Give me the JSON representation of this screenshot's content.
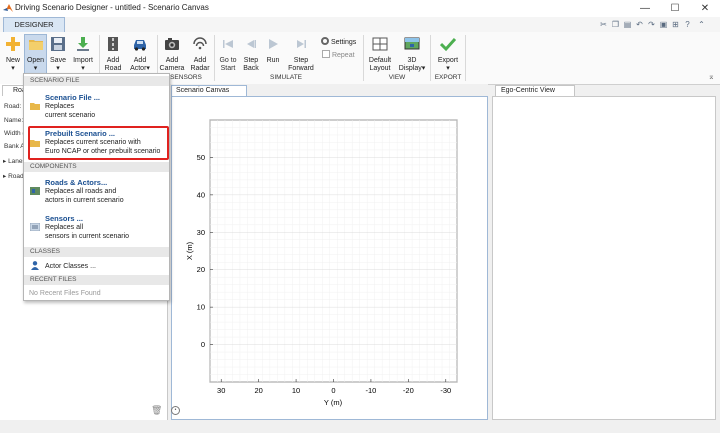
{
  "window": {
    "title": "Driving Scenario Designer - untitled - Scenario Canvas",
    "minimize": "—",
    "maximize": "☐",
    "close": "✕"
  },
  "toolstrip_tab": "DESIGNER",
  "ribbon": {
    "new_label": "New",
    "open_label": "Open",
    "save_label": "Save",
    "import_label": "Import",
    "add_road_1": "Add",
    "add_road_2": "Road",
    "add_actor_1": "Add",
    "add_actor_2": "Actor",
    "add_camera_1": "Add",
    "add_camera_2": "Camera",
    "add_radar_1": "Add",
    "add_radar_2": "Radar",
    "goto_start_1": "Go to",
    "goto_start_2": "Start",
    "step_back_1": "Step",
    "step_back_2": "Back",
    "run_label": "Run",
    "step_forward_1": "Step",
    "step_forward_2": "Forward",
    "settings_label": "Settings",
    "repeat_label": "Repeat",
    "default_layout_1": "Default",
    "default_layout_2": "Layout",
    "display3d_1": "3D",
    "display3d_2": "Display",
    "export_label": "Export",
    "section_sensors": "SENSORS",
    "section_simulate": "SIMULATE",
    "section_view": "VIEW",
    "section_export": "EXPORT"
  },
  "left_panel": {
    "tab_partial": "Roa",
    "road_label": "Road:",
    "name_label": "Name:",
    "width_label": "Width (",
    "bank_label": "Bank An",
    "lanes_label": "▸ Lanes",
    "road_center_label": "▸ Road"
  },
  "menu": {
    "header_scenario_file": "SCENARIO FILE",
    "scenario_file_title": "Scenario File ...",
    "scenario_file_desc1": "Replaces",
    "scenario_file_desc2": "current scenario",
    "prebuilt_title": "Prebuilt Scenario ...",
    "prebuilt_desc1": "Replaces current scenario with",
    "prebuilt_desc2": "Euro NCAP or other prebuilt scenario",
    "header_components": "COMPONENTS",
    "roads_actors_title": "Roads & Actors...",
    "roads_actors_desc1": "Replaces all roads and",
    "roads_actors_desc2": "actors in current scenario",
    "sensors_title": "Sensors ...",
    "sensors_desc1": "Replaces all",
    "sensors_desc2": "sensors in current scenario",
    "header_classes": "CLASSES",
    "actor_classes_title": "Actor Classes ...",
    "header_recent": "RECENT FILES",
    "no_recent": "No Recent Files Found"
  },
  "canvas": {
    "tab_label": "Scenario Canvas"
  },
  "ego": {
    "tab_label": "Ego-Centric View"
  },
  "chart_data": {
    "type": "scatter",
    "xlabel": "Y (m)",
    "ylabel": "X (m)",
    "xlim": [
      33,
      -33
    ],
    "ylim": [
      -10,
      60
    ],
    "x_ticks": [
      30,
      20,
      10,
      0,
      -10,
      -20,
      -30
    ],
    "y_ticks": [
      0,
      10,
      20,
      30,
      40,
      50
    ],
    "grid": true,
    "series": []
  },
  "colors": {
    "accent_blue": "#1a4f91",
    "highlight_red": "#e0221f",
    "grid": "#ececec"
  }
}
